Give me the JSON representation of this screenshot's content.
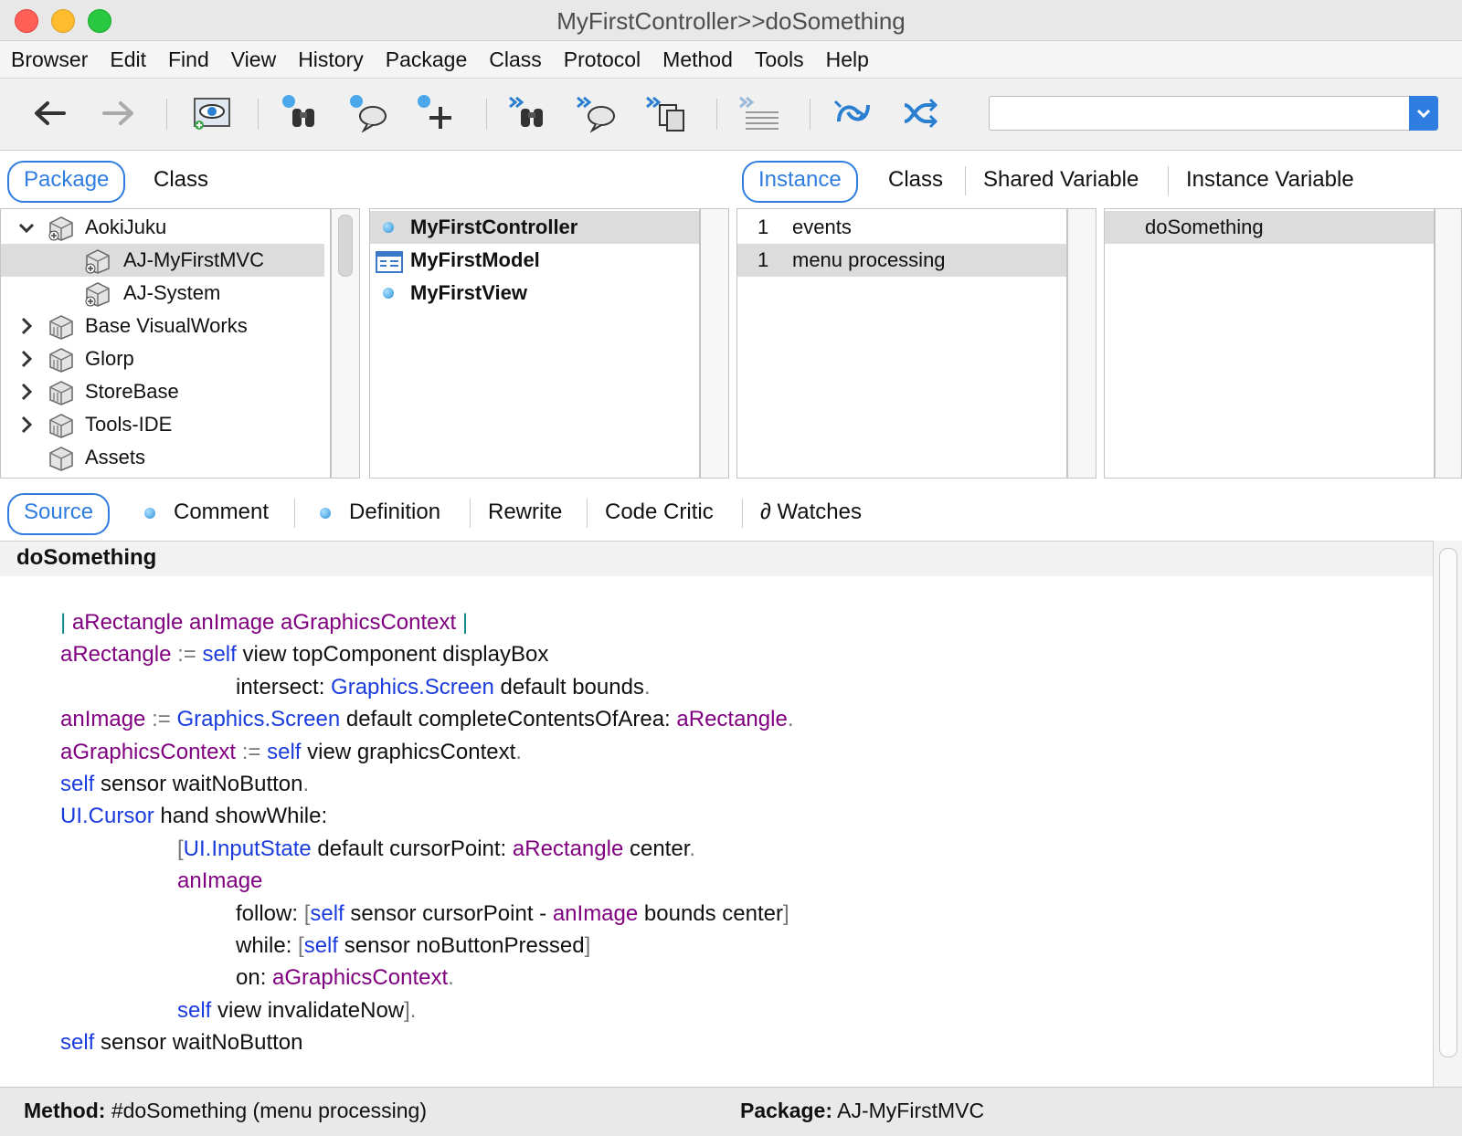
{
  "window": {
    "title": "MyFirstController>>doSomething"
  },
  "menubar": {
    "items": [
      "Browser",
      "Edit",
      "Find",
      "View",
      "History",
      "Package",
      "Class",
      "Protocol",
      "Method",
      "Tools",
      "Help"
    ]
  },
  "toolbar": {
    "icons": [
      "back-arrow-icon",
      "forward-arrow-icon",
      "visualize-icon",
      "find-binoculars-icon",
      "speech-bubble-icon",
      "add-plus-icon",
      "find-binoculars-all-icon",
      "speech-bubble-all-icon",
      "copy-documents-icon",
      "text-lines-icon",
      "refresh-icon",
      "shuffle-icon"
    ],
    "search_value": ""
  },
  "top_tabs": {
    "left": [
      "Package",
      "Class"
    ],
    "left_active": "Package",
    "right": [
      "Instance",
      "Class",
      "Shared Variable",
      "Instance Variable"
    ],
    "right_active": "Instance"
  },
  "packages": [
    {
      "label": "AokiJuku",
      "expanded": true,
      "level": 0
    },
    {
      "label": "AJ-MyFirstMVC",
      "level": 1,
      "selected": true
    },
    {
      "label": "AJ-System",
      "level": 1
    },
    {
      "label": "Base VisualWorks",
      "level": 0,
      "expandable": true
    },
    {
      "label": "Glorp",
      "level": 0,
      "expandable": true
    },
    {
      "label": "StoreBase",
      "level": 0,
      "expandable": true
    },
    {
      "label": "Tools-IDE",
      "level": 0,
      "expandable": true
    },
    {
      "label": "Assets",
      "level": 0
    }
  ],
  "classes": [
    {
      "label": "MyFirstController",
      "selected": true
    },
    {
      "label": "MyFirstModel"
    },
    {
      "label": "MyFirstView"
    }
  ],
  "protocols": [
    {
      "count": "1",
      "label": "events"
    },
    {
      "count": "1",
      "label": "menu processing",
      "selected": true
    }
  ],
  "methods": [
    {
      "label": "doSomething",
      "selected": true
    }
  ],
  "bottom_tabs": {
    "items": [
      "Source",
      "Comment",
      "Definition",
      "Rewrite",
      "Code Critic",
      "∂ Watches"
    ],
    "active": "Source"
  },
  "source": {
    "method_name": "doSomething",
    "lines": [
      [
        [
          "bar",
          "| "
        ],
        [
          "var",
          "aRectangle anImage aGraphicsContext"
        ],
        [
          "bar",
          " |"
        ]
      ],
      [
        [
          "var",
          "aRectangle"
        ],
        [
          "punct",
          " := "
        ],
        [
          "self",
          "self"
        ],
        [
          "plain",
          " view topComponent displayBox"
        ]
      ],
      [
        [
          "plain",
          "intersect: "
        ],
        [
          "glob",
          "Graphics.Screen"
        ],
        [
          "plain",
          " default bounds"
        ],
        [
          "punct",
          "."
        ]
      ],
      [
        [
          "var",
          "anImage"
        ],
        [
          "punct",
          " := "
        ],
        [
          "glob",
          "Graphics.Screen"
        ],
        [
          "plain",
          " default completeContentsOfArea: "
        ],
        [
          "var",
          "aRectangle"
        ],
        [
          "punct",
          "."
        ]
      ],
      [
        [
          "var",
          "aGraphicsContext"
        ],
        [
          "punct",
          " := "
        ],
        [
          "self",
          "self"
        ],
        [
          "plain",
          " view graphicsContext"
        ],
        [
          "punct",
          "."
        ]
      ],
      [
        [
          "self",
          "self"
        ],
        [
          "plain",
          " sensor waitNoButton"
        ],
        [
          "punct",
          "."
        ]
      ],
      [
        [
          "glob",
          "UI.Cursor"
        ],
        [
          "plain",
          " hand showWhile:"
        ]
      ],
      [
        [
          "punct",
          "["
        ],
        [
          "glob",
          "UI.InputState"
        ],
        [
          "plain",
          " default cursorPoint: "
        ],
        [
          "var",
          "aRectangle"
        ],
        [
          "plain",
          " center"
        ],
        [
          "punct",
          "."
        ]
      ],
      [
        [
          "var",
          "anImage"
        ]
      ],
      [
        [
          "plain",
          "follow: "
        ],
        [
          "punct",
          "["
        ],
        [
          "self",
          "self"
        ],
        [
          "plain",
          " sensor cursorPoint - "
        ],
        [
          "var",
          "anImage"
        ],
        [
          "plain",
          " bounds center"
        ],
        [
          "punct",
          "]"
        ]
      ],
      [
        [
          "plain",
          "while: "
        ],
        [
          "punct",
          "["
        ],
        [
          "self",
          "self"
        ],
        [
          "plain",
          " sensor noButtonPressed"
        ],
        [
          "punct",
          "]"
        ]
      ],
      [
        [
          "plain",
          "on: "
        ],
        [
          "var",
          "aGraphicsContext"
        ],
        [
          "punct",
          "."
        ]
      ],
      [
        [
          "self",
          "self"
        ],
        [
          "plain",
          " view invalidateNow"
        ],
        [
          "punct",
          "]."
        ]
      ],
      [
        [
          "self",
          "self"
        ],
        [
          "plain",
          " sensor waitNoButton"
        ]
      ]
    ]
  },
  "status": {
    "method_label": "Method:",
    "method_value": "#doSomething (menu processing)",
    "package_label": "Package:",
    "package_value": "AJ-MyFirstMVC"
  }
}
